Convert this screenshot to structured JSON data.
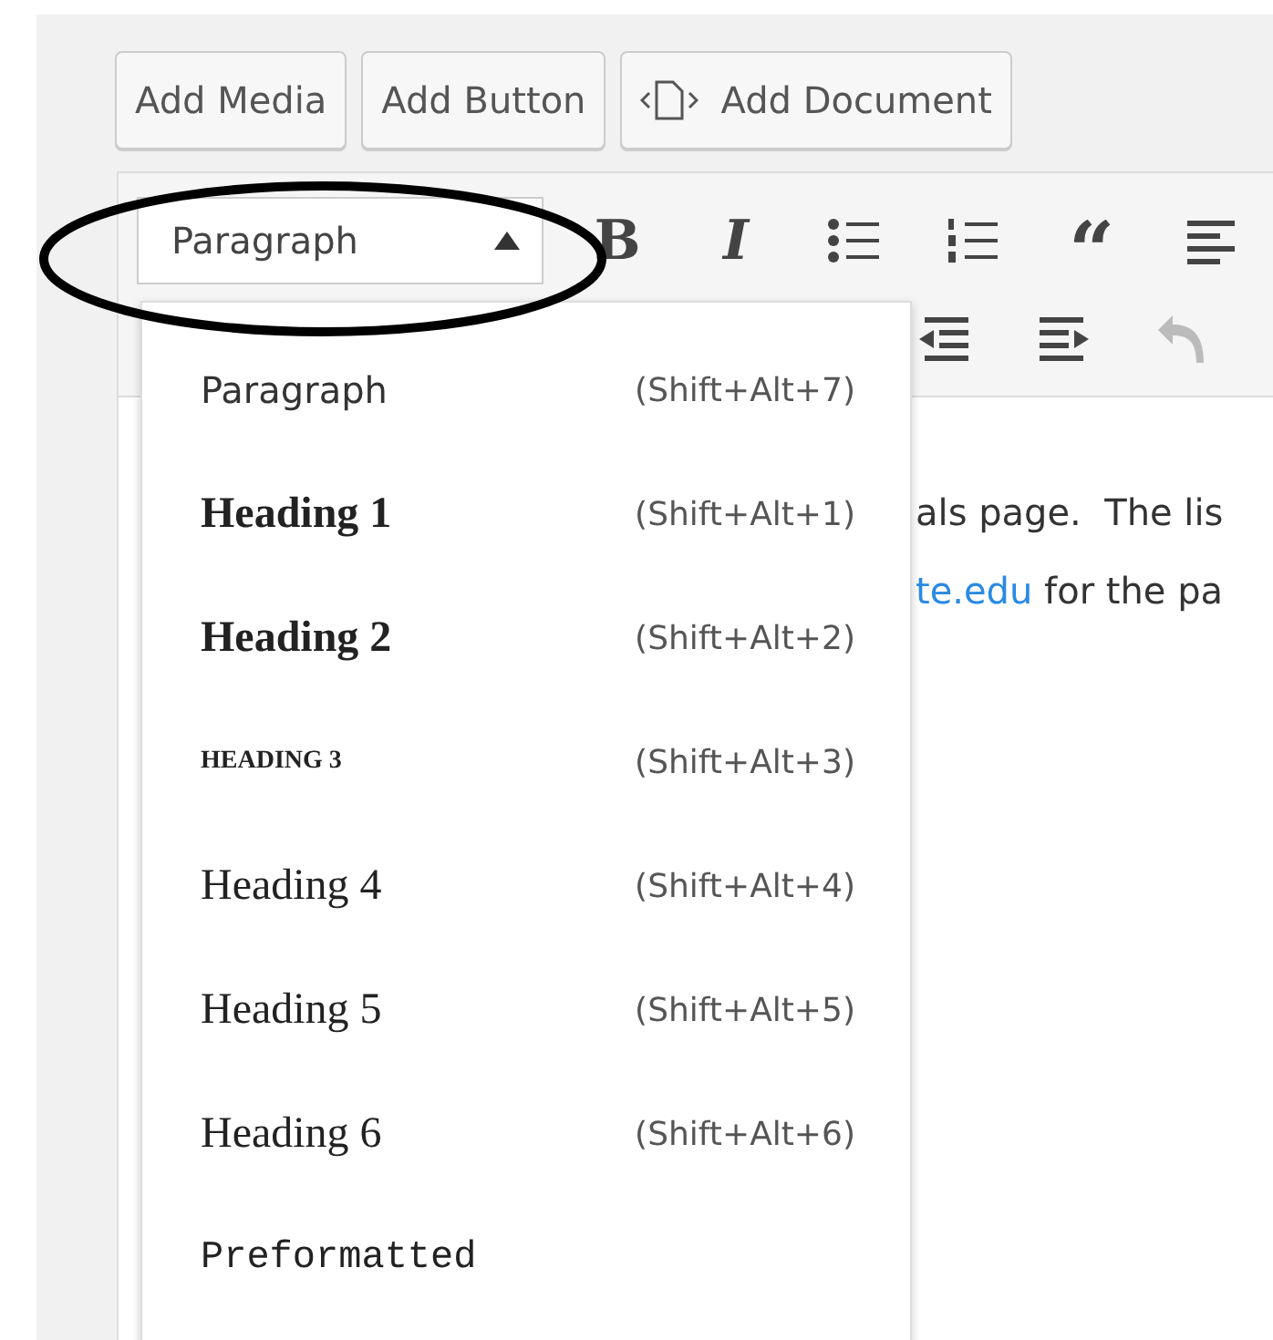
{
  "media_buttons": [
    {
      "label": "Add Media",
      "icon": false
    },
    {
      "label": "Add Button",
      "icon": false
    },
    {
      "label": "Add Document",
      "icon": true
    }
  ],
  "format_select": {
    "value": "Paragraph",
    "expanded": true
  },
  "toolbar_row_1": [
    {
      "kind": "bold",
      "label": "B",
      "disabled": false
    },
    {
      "kind": "italic",
      "label": "I",
      "disabled": false
    },
    {
      "kind": "bullet-list",
      "disabled": false
    },
    {
      "kind": "numbered-list",
      "disabled": false
    },
    {
      "kind": "quote",
      "label": "“",
      "disabled": false
    },
    {
      "kind": "align-left",
      "disabled": false
    }
  ],
  "toolbar_row_2": [
    {
      "kind": "outdent",
      "disabled": false
    },
    {
      "kind": "indent",
      "disabled": false
    },
    {
      "kind": "undo",
      "disabled": true
    }
  ],
  "content": {
    "lines": [
      [
        {
          "text": "als page.  The lis",
          "link": false
        }
      ],
      [
        {
          "text": "te.edu",
          "link": true
        },
        {
          "text": " for the pa",
          "link": false
        }
      ]
    ]
  },
  "format_menu": [
    {
      "kind": "paragraph",
      "label": "Paragraph",
      "shortcut": "(Shift+Alt+7)"
    },
    {
      "kind": "h1",
      "label": "Heading 1",
      "shortcut": "(Shift+Alt+1)"
    },
    {
      "kind": "h2",
      "label": "Heading 2",
      "shortcut": "(Shift+Alt+2)"
    },
    {
      "kind": "h3",
      "label": "HEADING 3",
      "shortcut": "(Shift+Alt+3)"
    },
    {
      "kind": "h4",
      "label": "Heading 4",
      "shortcut": "(Shift+Alt+4)"
    },
    {
      "kind": "h5",
      "label": "Heading 5",
      "shortcut": "(Shift+Alt+5)"
    },
    {
      "kind": "h6",
      "label": "Heading 6",
      "shortcut": "(Shift+Alt+6)"
    },
    {
      "kind": "pre",
      "label": "Preformatted"
    }
  ]
}
